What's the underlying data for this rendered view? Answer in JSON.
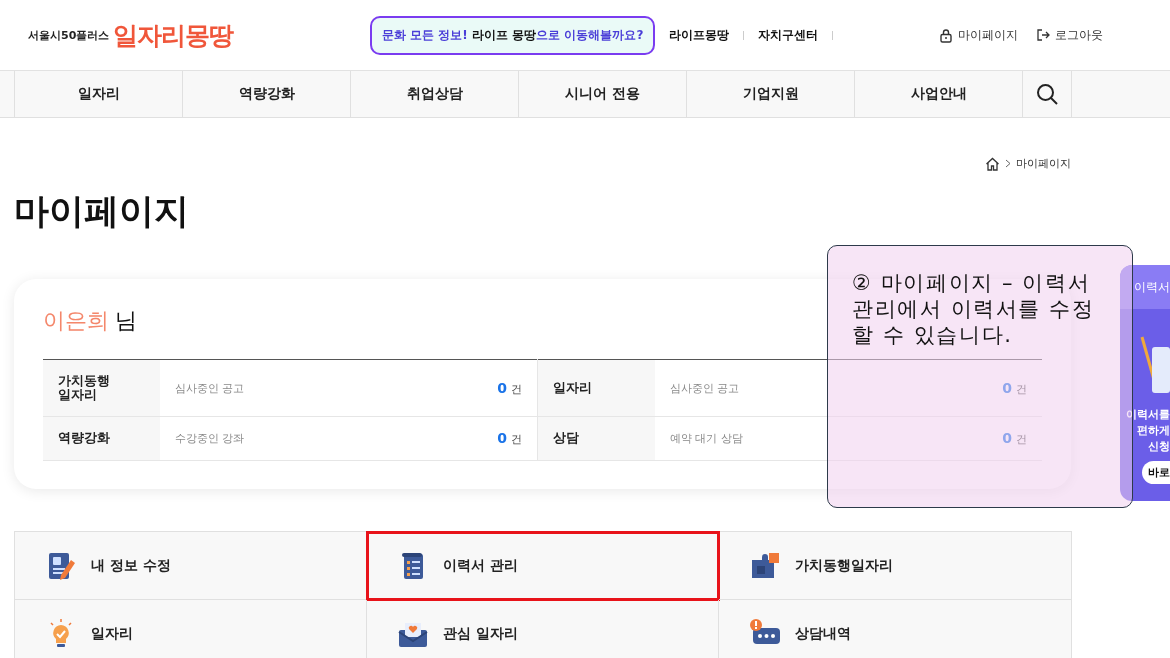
{
  "header": {
    "logo_small": "서울시50플러스",
    "logo_main": "일자리몽땅",
    "promo": "문화 모든 정보! **라이프 몽땅**으로 이동해볼까요?",
    "links": [
      "라이프몽땅",
      "자치구센터"
    ],
    "user_links": [
      "마이페이지",
      "로그아웃"
    ]
  },
  "nav": {
    "items": [
      "일자리",
      "역량강화",
      "취업상담",
      "시니어 전용",
      "기업지원",
      "사업안내"
    ]
  },
  "breadcrumb": [
    "마이페이지"
  ],
  "page_title": "마이페이지",
  "profile": {
    "name": "이은희",
    "suffix": "님",
    "rows": [
      [
        {
          "label": "가치동행\n일자리",
          "desc": "심사중인 공고",
          "count": "0",
          "unit": "건"
        },
        {
          "label": "일자리",
          "desc": "심사중인 공고",
          "count": "0",
          "unit": "건"
        }
      ],
      [
        {
          "label": "역량강화",
          "desc": "수강중인 강좌",
          "count": "0",
          "unit": "건"
        },
        {
          "label": "상담",
          "desc": "예약 대기 상담",
          "count": "0",
          "unit": "건"
        }
      ]
    ]
  },
  "menu": [
    {
      "label": "내 정보 수정",
      "highlighted": false
    },
    {
      "label": "이력서 관리",
      "highlighted": true
    },
    {
      "label": "가치동행일자리",
      "highlighted": false
    },
    {
      "label": "일자리",
      "highlighted": false
    },
    {
      "label": "관심 일자리",
      "highlighted": false
    },
    {
      "label": "상담내역",
      "highlighted": false
    }
  ],
  "callout": {
    "text": "② 마이페이지 – 이력서 관리에서 이력서를 수정할 수 있습니다."
  },
  "side_banner": {
    "title": "이력서",
    "lines": [
      "이력서를",
      "편하게",
      "신청"
    ],
    "button": "바로"
  }
}
